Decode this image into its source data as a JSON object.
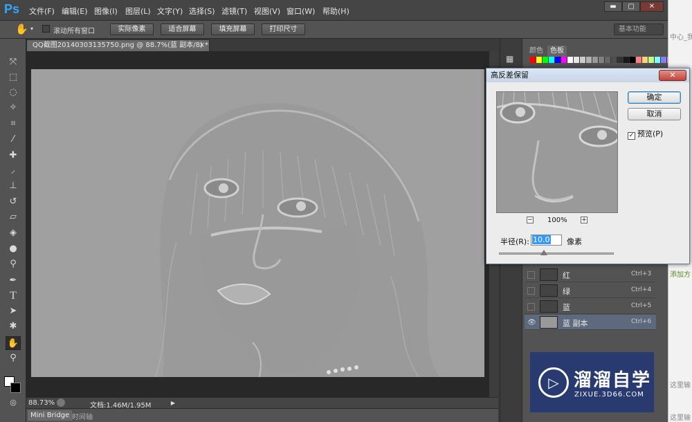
{
  "app": {
    "logo": "Ps"
  },
  "menu": [
    "文件(F)",
    "编辑(E)",
    "图像(I)",
    "图层(L)",
    "文字(Y)",
    "选择(S)",
    "滤镜(T)",
    "视图(V)",
    "窗口(W)",
    "帮助(H)"
  ],
  "window_controls": {
    "minimize": "▬",
    "maximize": "▢",
    "close": "✕"
  },
  "options": {
    "scroll_all_label": "滚动所有窗口",
    "buttons": [
      "实际像素",
      "适合屏幕",
      "填充屏幕",
      "打印尺寸"
    ],
    "workspace": "基本功能"
  },
  "document": {
    "tab_title": "QQ截图20140303135750.png @ 88.7%(蓝 副本/8) *",
    "close": "×"
  },
  "status": {
    "zoom": "88.73%",
    "doc_info": "文档:1.46M/1.95M"
  },
  "bottom": {
    "mini_bridge": "Mini Bridge",
    "timeline": "时间轴"
  },
  "panels": {
    "tabs": [
      "颜色",
      "色板"
    ]
  },
  "layers": [
    {
      "name": "红",
      "shortcut": "Ctrl+3",
      "selected": false
    },
    {
      "name": "绿",
      "shortcut": "Ctrl+4",
      "selected": false
    },
    {
      "name": "蓝",
      "shortcut": "Ctrl+5",
      "selected": false
    },
    {
      "name": "蓝 副本",
      "shortcut": "Ctrl+6",
      "selected": true
    }
  ],
  "dialog": {
    "title": "高反差保留",
    "ok": "确定",
    "cancel": "取消",
    "preview_label": "预览(P)",
    "preview_checked": true,
    "zoom": "100%",
    "radius_label": "半径(R):",
    "radius_value": "10.0",
    "radius_unit": "像素",
    "radius_slider_level": 0.4
  },
  "watermark": {
    "title": "溜溜自学",
    "url": "ZIXUE.3D66.COM"
  },
  "browser_fragments": [
    "中心_我的",
    "添加方",
    "这里输",
    "这里输"
  ],
  "swatch_colors": [
    "#ff0000",
    "#ffff00",
    "#00ff00",
    "#00ffff",
    "#0000ff",
    "#ff00ff",
    "#ffffff",
    "#e6e6e6",
    "#cccccc",
    "#b3b3b3",
    "#999999",
    "#808080",
    "#666666",
    "#4d4d4d",
    "#333333",
    "#1a1a1a",
    "#000000",
    "#ff8080",
    "#ffd280",
    "#c0ff80",
    "#80ffff",
    "#8080ff",
    "#ff80c0"
  ]
}
